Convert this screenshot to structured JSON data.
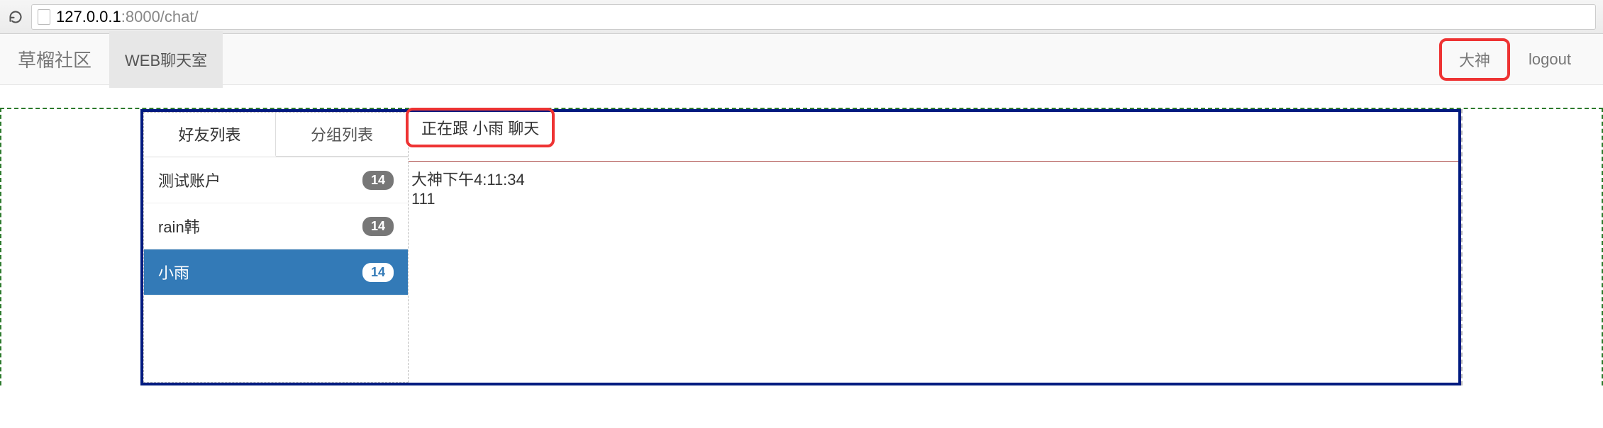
{
  "browser": {
    "url_host": "127.0.0.1",
    "url_port_path": ":8000/chat/"
  },
  "nav": {
    "brand": "草榴社区",
    "room": "WEB聊天室",
    "user": "大神",
    "logout": "logout"
  },
  "sidebar": {
    "tabs": {
      "friends": "好友列表",
      "groups": "分组列表"
    },
    "items": [
      {
        "name": "测试账户",
        "badge": "14",
        "selected": false
      },
      {
        "name": "rain韩",
        "badge": "14",
        "selected": false
      },
      {
        "name": "小雨",
        "badge": "14",
        "selected": true
      }
    ]
  },
  "chat": {
    "talking_with": "正在跟 小雨 聊天",
    "messages": [
      {
        "meta": "大神下午4:11:34",
        "text": "111"
      }
    ]
  }
}
